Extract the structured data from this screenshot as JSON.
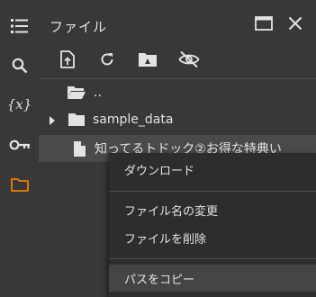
{
  "sidebar": {
    "items": [
      {
        "icon": "table-of-contents-icon"
      },
      {
        "icon": "search-icon"
      },
      {
        "icon": "code-snippets-icon",
        "label": "{x}"
      },
      {
        "icon": "key-icon"
      },
      {
        "icon": "folder-icon",
        "active": true
      }
    ],
    "accent": "#f57c00"
  },
  "panel": {
    "title": "ファイル",
    "toolbar": [
      "upload-file-icon",
      "refresh-icon",
      "mount-drive-icon",
      "hide-icon"
    ]
  },
  "files": {
    "parent": "..",
    "folder": "sample_data",
    "file": "知ってるトドック②お得な特典い"
  },
  "context_menu": {
    "download": "ダウンロード",
    "rename": "ファイル名の変更",
    "delete": "ファイルを削除",
    "copy_path": "パスをコピー"
  },
  "colors": {
    "background": "#383838",
    "menu_background": "#2d2d2d",
    "text": "#e3e3e3"
  }
}
